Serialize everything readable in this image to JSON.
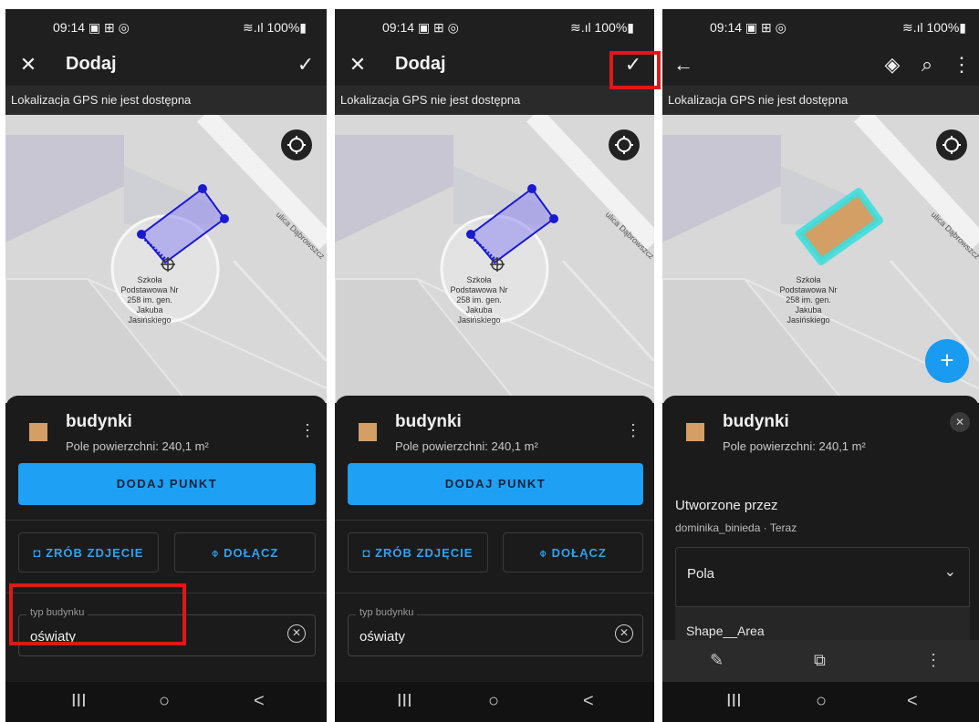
{
  "panels": [
    {
      "status": {
        "time": "09:14 ▣ ⊞ ◎",
        "battery": "≋.ıl 100%▮"
      },
      "toolbar": {
        "close_icon": "✕",
        "title": "Dodaj",
        "confirm_icon": "✓"
      },
      "gps_banner": "Lokalizacja GPS nie jest dostępna",
      "map": {
        "street": "ulica Dąbrowszcz",
        "label_lines": [
          "Szkoła",
          "Podstawowa Nr",
          "258 im. gen.",
          "Jakuba",
          "Jasińskiego"
        ]
      },
      "sheet": {
        "layer": "budynki",
        "area": "Pole powierzchni: 240,1 m²",
        "add_point": "DODAJ PUNKT",
        "photo": "ZRÓB ZDJĘCIE",
        "attach": "DOŁĄCZ",
        "field_label": "typ budynku",
        "field_value": "oświaty"
      }
    },
    {
      "status": {
        "time": "09:14 ▣ ⊞ ◎",
        "battery": "≋.ıl 100%▮"
      },
      "toolbar": {
        "close_icon": "✕",
        "title": "Dodaj",
        "confirm_icon": "✓"
      },
      "gps_banner": "Lokalizacja GPS nie jest dostępna",
      "map": {
        "street": "ulica Dąbrowszcz",
        "label_lines": [
          "Szkoła",
          "Podstawowa Nr",
          "258 im. gen.",
          "Jakuba",
          "Jasińskiego"
        ]
      },
      "sheet": {
        "layer": "budynki",
        "area": "Pole powierzchni: 240,1 m²",
        "add_point": "DODAJ PUNKT",
        "photo": "ZRÓB ZDJĘCIE",
        "attach": "DOŁĄCZ",
        "field_label": "typ budynku",
        "field_value": "oświaty"
      }
    },
    {
      "status": {
        "time": "09:14 ▣ ⊞ ◎",
        "battery": "≋.ıl 100%▮"
      },
      "toolbar": {
        "back_icon": "←",
        "layers_icon": "◈",
        "search_icon": "⌕",
        "menu_icon": "⋮"
      },
      "gps_banner": "Lokalizacja GPS nie jest dostępna",
      "map": {
        "street": "ulica Dąbrowszcz",
        "label_lines": [
          "Szkoła",
          "Podstawowa Nr",
          "258 im. gen.",
          "Jakuba",
          "Jasińskiego"
        ],
        "fab": "+"
      },
      "sheet": {
        "layer": "budynki",
        "area": "Pole powierzchni: 240,1 m²",
        "created_by_label": "Utworzone przez",
        "creator": "dominika_binieda · Teraz",
        "section": "Pola",
        "field_name": "Shape__Area"
      }
    }
  ],
  "nav": {
    "recents": "III",
    "home": "○",
    "back": "<"
  },
  "icons": {
    "camera": "camera-icon",
    "paperclip": "paperclip-icon",
    "clear": "clear-circle-icon",
    "kebab": "more-vert-icon",
    "edit": "pencil-icon",
    "copy": "copy-icon",
    "locate": "crosshair-icon"
  },
  "colors": {
    "accent": "#1ea0f5",
    "highlight": "#e01717",
    "polygon_fill": "#d39f64",
    "sketch": "#1a1ad0",
    "select_glow": "#35e0e0"
  }
}
